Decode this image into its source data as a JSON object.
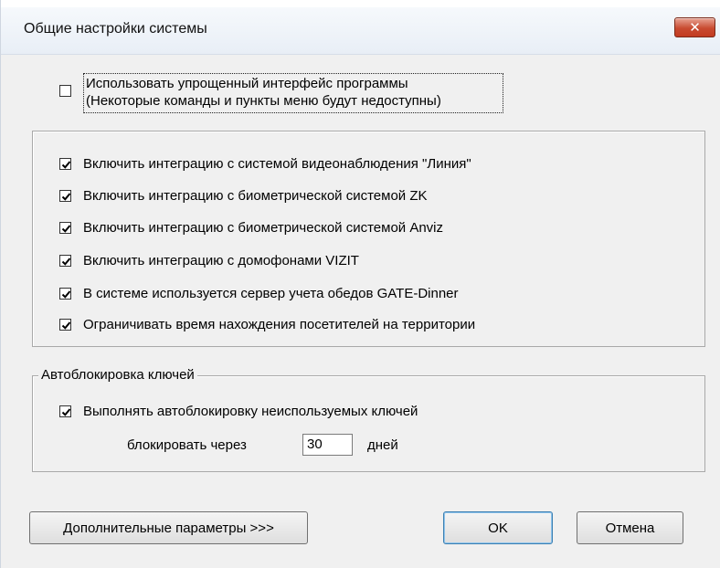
{
  "window": {
    "title": "Общие настройки системы",
    "close_symbol": "✕"
  },
  "simplified_mode": {
    "checked": false,
    "line1": "Использовать упрощенный интерфейс программы",
    "line2": "(Некоторые команды и пункты меню будут недоступны)"
  },
  "integrations": [
    {
      "checked": true,
      "label": "Включить интеграцию с системой видеонаблюдения \"Линия\""
    },
    {
      "checked": true,
      "label": "Включить интеграцию с биометрической системой ZK"
    },
    {
      "checked": true,
      "label": "Включить интеграцию с биометрической системой Anviz"
    },
    {
      "checked": true,
      "label": "Включить интеграцию с домофонами VIZIT"
    },
    {
      "checked": true,
      "label": "В системе используется сервер учета обедов GATE-Dinner"
    },
    {
      "checked": true,
      "label": "Ограничивать время нахождения посетителей на территории"
    }
  ],
  "autoblock": {
    "group_title": "Автоблокировка ключей",
    "checkbox_checked": true,
    "checkbox_label": "Выполнять автоблокировку неиспользуемых ключей",
    "block_after_label": "блокировать через",
    "days_value": "30",
    "days_unit": "дней"
  },
  "buttons": {
    "advanced": "Дополнительные параметры >>>",
    "ok": "OK",
    "cancel": "Отмена"
  },
  "colors": {
    "dialog_background": "#f0f0f0",
    "close_button": "#c84b31"
  }
}
